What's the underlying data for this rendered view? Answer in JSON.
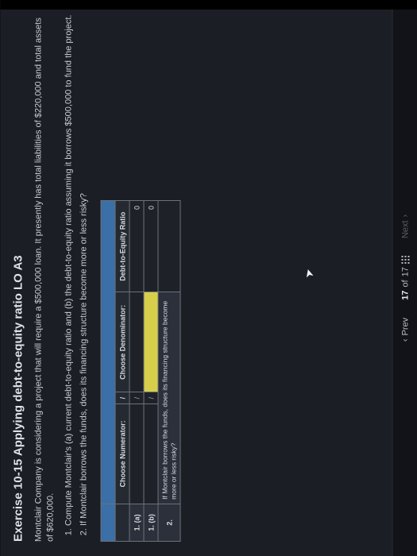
{
  "exercise": {
    "title": "Exercise 10-15 Applying debt-to-equity ratio LO A3",
    "intro": "Montclair Company is considering a project that will require a $500,000 loan. It presently has total liabilities of $220,000 and total assets of $620,000.",
    "requirements": [
      "Compute Montclair's (a) current debt-to-equity ratio and (b) the debt-to-equity ratio assuming it borrows $500,000 to fund the project.",
      "If Montclair borrows the funds, does its financing structure become more or less risky?"
    ],
    "table": {
      "col_numerator": "Choose Numerator:",
      "col_sep": "/",
      "col_denominator": "Choose Denominator:",
      "col_ratio": "Debt-to-Equity Ratio",
      "rows": [
        {
          "label": "1. (a)",
          "numerator": "",
          "denominator": "",
          "ratio": "0"
        },
        {
          "label": "1. (b)",
          "numerator": "",
          "denominator": "",
          "ratio": "0"
        }
      ],
      "q2_label": "2.",
      "q2_text": "If Montclair borrows the funds, does its financing structure become more or less risky?",
      "q2_answer": ""
    }
  },
  "footer": {
    "prev": "Prev",
    "page_current": "17",
    "page_sep": "of",
    "page_total": "17",
    "next": "Next"
  }
}
